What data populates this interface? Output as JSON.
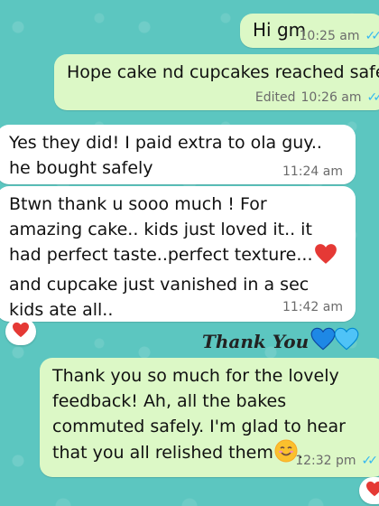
{
  "messages": [
    {
      "id": "m1",
      "direction": "outgoing",
      "text": "Hi gm",
      "time": "10:25 am"
    },
    {
      "id": "m2",
      "direction": "outgoing",
      "text": "Hope cake nd cupcakes reached safel",
      "edited": "Edited",
      "time": "10:26 am"
    },
    {
      "id": "m3",
      "direction": "incoming",
      "text": "Yes they did! I paid extra to ola guy.. he bought safely",
      "time": "11:24 am"
    },
    {
      "id": "m4",
      "direction": "incoming",
      "text_before": "Btwn thank u sooo much ! For amazing cake.. kids just loved it.. it had perfect taste..perfect texture...",
      "text_after": "and cupcake just vanished in a sec kids ate all..",
      "time": "11:42 am",
      "reaction": "red-heart"
    },
    {
      "id": "m5",
      "direction": "outgoing",
      "type": "sticker",
      "text": "Thank You"
    },
    {
      "id": "m6",
      "direction": "outgoing",
      "text": "Thank you so much for the lovely feedback! Ah, all the bakes commuted safely. I'm glad to hear that you all relished them",
      "emoji": "smiling-face-icon",
      "after_emoji": ".",
      "time": "12:32 pm",
      "reaction": "red-heart"
    }
  ],
  "colors": {
    "wallpaper": "#5cc6c0",
    "outgoing_bubble": "#dcf8c6",
    "incoming_bubble": "#ffffff",
    "read_ticks": "#34b7f1",
    "heart": "#e53935",
    "blue_heart": "#1e88e5",
    "light_blue_heart": "#4fc3f7"
  }
}
